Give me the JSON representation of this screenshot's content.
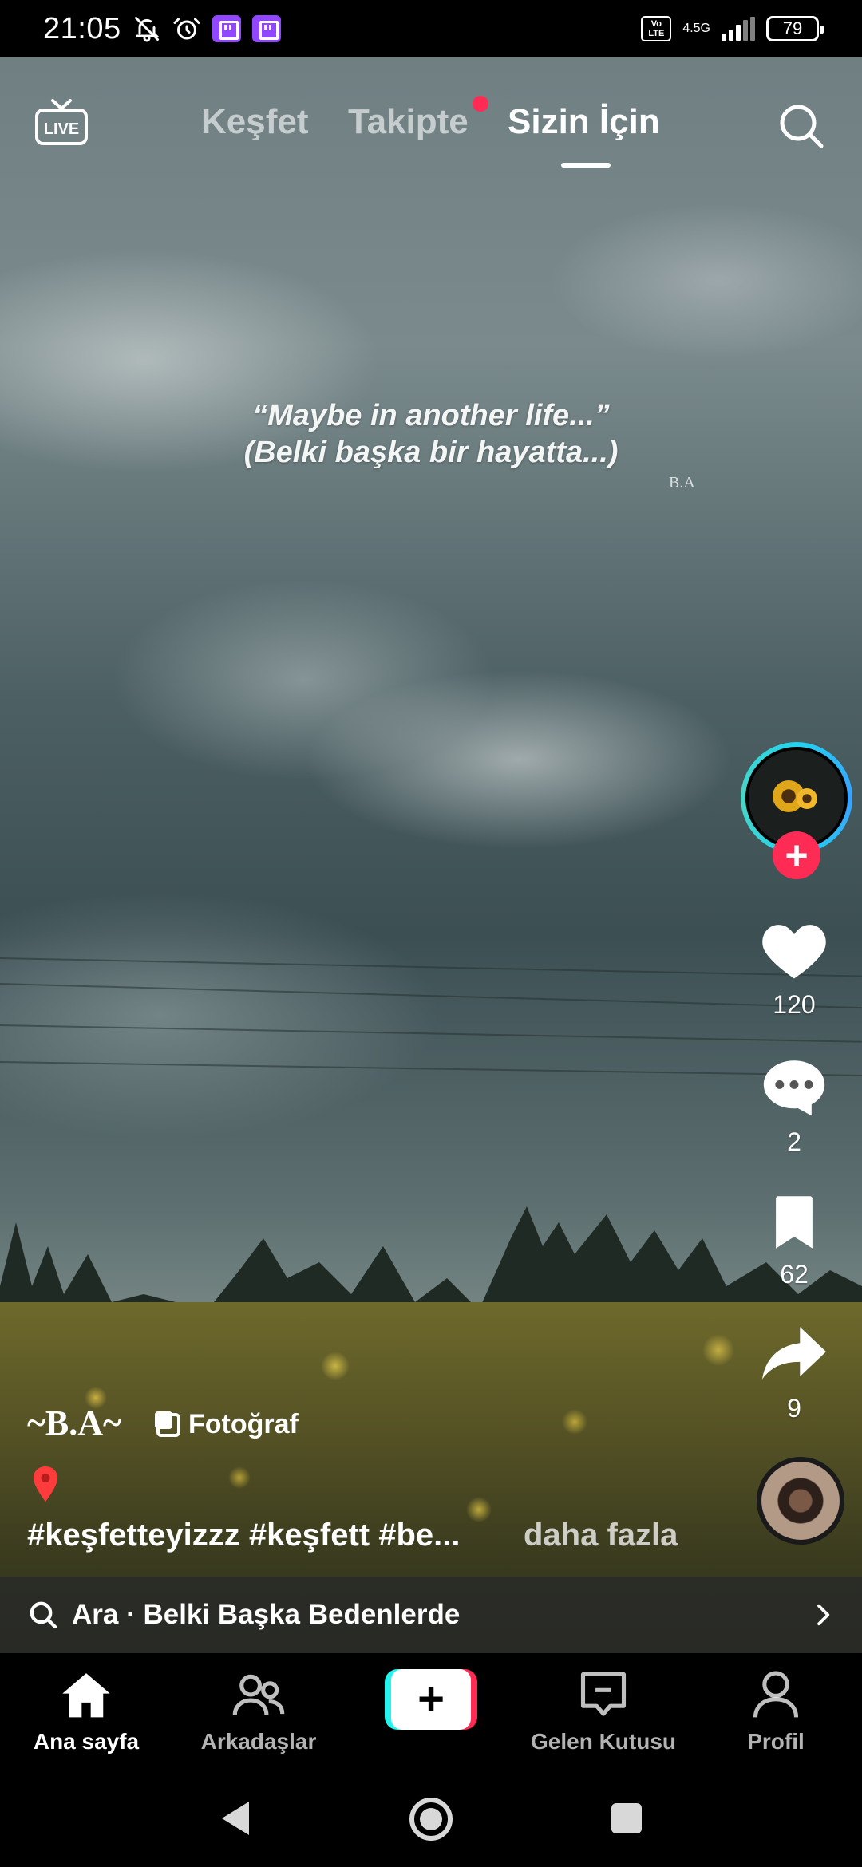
{
  "status_bar": {
    "time": "21:05",
    "network_badge": "Vo LTE",
    "network_type": "4.5G",
    "battery": "79"
  },
  "top_nav": {
    "tabs": [
      {
        "label": "Keşfet",
        "active": false
      },
      {
        "label": "Takipte",
        "active": false,
        "has_dot": true
      },
      {
        "label": "Sizin İçin",
        "active": true
      }
    ],
    "live_label": "LIVE"
  },
  "video": {
    "overlay_line1": "“Maybe in another life...”",
    "overlay_line2": "(Belki başka bir hayatta...)",
    "watermark": "B.A"
  },
  "actions": {
    "likes": "120",
    "comments": "2",
    "saves": "62",
    "shares": "9"
  },
  "post": {
    "author": "~B.A~",
    "type_badge": "Fotoğraf",
    "location_icon": "pin-icon",
    "caption": "#keşfetteyizzz #keşfett #be...",
    "more_label": "daha fazla"
  },
  "search_suggestion": {
    "label": "Ara · Belki Başka Bedenlerde"
  },
  "bottom_nav": {
    "items": [
      {
        "label": "Ana sayfa",
        "icon": "home-icon",
        "active": true
      },
      {
        "label": "Arkadaşlar",
        "icon": "friends-icon",
        "active": false
      },
      {
        "label": "",
        "icon": "create-icon",
        "active": false
      },
      {
        "label": "Gelen Kutusu",
        "icon": "inbox-icon",
        "active": false
      },
      {
        "label": "Profil",
        "icon": "profile-icon",
        "active": false
      }
    ]
  },
  "colors": {
    "accent_red": "#fe2c55",
    "accent_cyan": "#25f4ee",
    "twitch_purple": "#9146ff"
  }
}
